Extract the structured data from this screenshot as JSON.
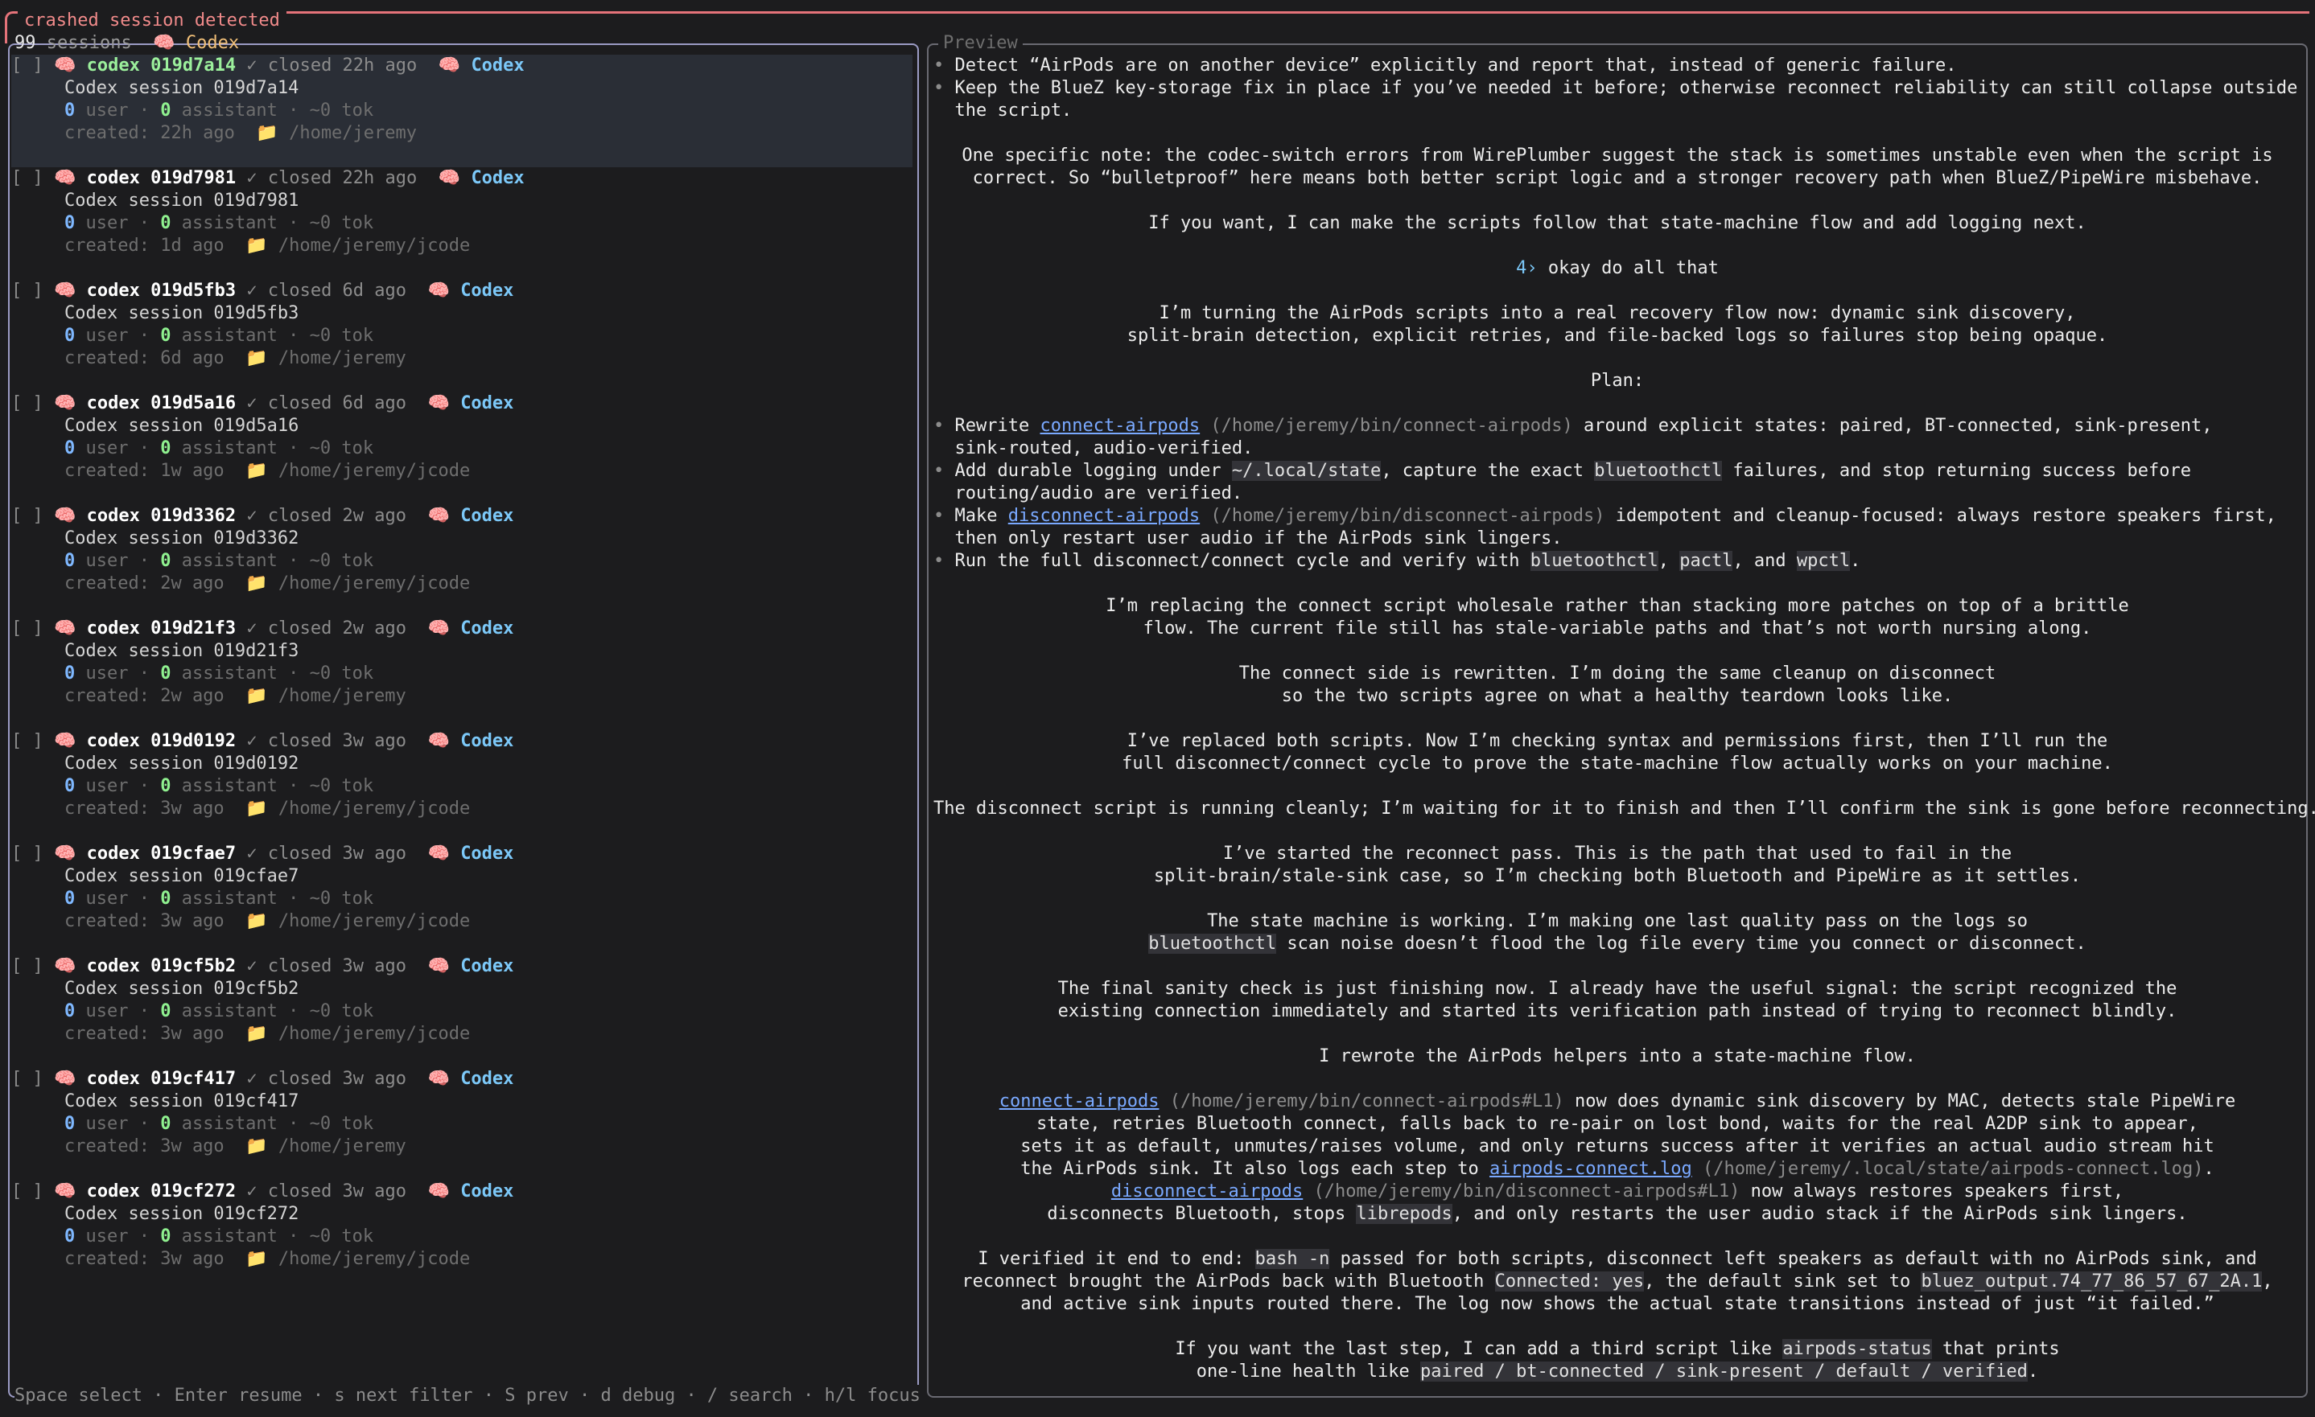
{
  "frame_title": "crashed session detected",
  "left": {
    "count": "99",
    "sessions_word": " sessions",
    "filter": "Codex",
    "footer": "Space select · Enter resume · s next filter · S prev · d debug · / search · h/l focus"
  },
  "sessions": [
    {
      "name": "codex 019d7a14",
      "closed": "closed 22h ago",
      "agent": "Codex",
      "title": "Codex session 019d7a14",
      "user": "0",
      "assistant": "0",
      "tok": "~0 tok",
      "created": "created: 22h ago",
      "path": "/home/jeremy"
    },
    {
      "name": "codex 019d7981",
      "closed": "closed 22h ago",
      "agent": "Codex",
      "title": "Codex session 019d7981",
      "user": "0",
      "assistant": "0",
      "tok": "~0 tok",
      "created": "created: 1d ago",
      "path": "/home/jeremy/jcode"
    },
    {
      "name": "codex 019d5fb3",
      "closed": "closed 6d ago",
      "agent": "Codex",
      "title": "Codex session 019d5fb3",
      "user": "0",
      "assistant": "0",
      "tok": "~0 tok",
      "created": "created: 6d ago",
      "path": "/home/jeremy"
    },
    {
      "name": "codex 019d5a16",
      "closed": "closed 6d ago",
      "agent": "Codex",
      "title": "Codex session 019d5a16",
      "user": "0",
      "assistant": "0",
      "tok": "~0 tok",
      "created": "created: 1w ago",
      "path": "/home/jeremy/jcode"
    },
    {
      "name": "codex 019d3362",
      "closed": "closed 2w ago",
      "agent": "Codex",
      "title": "Codex session 019d3362",
      "user": "0",
      "assistant": "0",
      "tok": "~0 tok",
      "created": "created: 2w ago",
      "path": "/home/jeremy/jcode"
    },
    {
      "name": "codex 019d21f3",
      "closed": "closed 2w ago",
      "agent": "Codex",
      "title": "Codex session 019d21f3",
      "user": "0",
      "assistant": "0",
      "tok": "~0 tok",
      "created": "created: 2w ago",
      "path": "/home/jeremy"
    },
    {
      "name": "codex 019d0192",
      "closed": "closed 3w ago",
      "agent": "Codex",
      "title": "Codex session 019d0192",
      "user": "0",
      "assistant": "0",
      "tok": "~0 tok",
      "created": "created: 3w ago",
      "path": "/home/jeremy/jcode"
    },
    {
      "name": "codex 019cfae7",
      "closed": "closed 3w ago",
      "agent": "Codex",
      "title": "Codex session 019cfae7",
      "user": "0",
      "assistant": "0",
      "tok": "~0 tok",
      "created": "created: 3w ago",
      "path": "/home/jeremy/jcode"
    },
    {
      "name": "codex 019cf5b2",
      "closed": "closed 3w ago",
      "agent": "Codex",
      "title": "Codex session 019cf5b2",
      "user": "0",
      "assistant": "0",
      "tok": "~0 tok",
      "created": "created: 3w ago",
      "path": "/home/jeremy/jcode"
    },
    {
      "name": "codex 019cf417",
      "closed": "closed 3w ago",
      "agent": "Codex",
      "title": "Codex session 019cf417",
      "user": "0",
      "assistant": "0",
      "tok": "~0 tok",
      "created": "created: 3w ago",
      "path": "/home/jeremy"
    },
    {
      "name": "codex 019cf272",
      "closed": "closed 3w ago",
      "agent": "Codex",
      "title": "Codex session 019cf272",
      "user": "0",
      "assistant": "0",
      "tok": "~0 tok",
      "created": "created: 3w ago",
      "path": "/home/jeremy/jcode"
    }
  ],
  "preview": {
    "title": "Preview",
    "lines": [
      {
        "align": "left",
        "bullet": true,
        "segs": [
          {
            "t": "Detect “AirPods are on another device” explicitly and report that, instead of generic failure."
          }
        ]
      },
      {
        "align": "left",
        "bullet": true,
        "segs": [
          {
            "t": "Keep the BlueZ key-storage fix in place if you’ve needed it before; otherwise reconnect reliability can still collapse outside"
          }
        ]
      },
      {
        "align": "left",
        "indent": true,
        "segs": [
          {
            "t": "the script."
          }
        ]
      },
      {
        "align": "left",
        "segs": []
      },
      {
        "align": "center",
        "segs": [
          {
            "t": "One specific note: the codec-switch errors from WirePlumber suggest the stack is sometimes unstable even when the script is"
          }
        ]
      },
      {
        "align": "center",
        "segs": [
          {
            "t": "correct. So “bulletproof” here means both better script logic and a stronger recovery path when BlueZ/PipeWire misbehave."
          }
        ]
      },
      {
        "align": "left",
        "segs": []
      },
      {
        "align": "center",
        "segs": [
          {
            "t": "If you want, I can make the scripts follow that state-machine flow and add logging next."
          }
        ]
      },
      {
        "align": "left",
        "segs": []
      },
      {
        "align": "center",
        "segs": [
          {
            "t": "4›",
            "s": "prompt"
          },
          {
            "t": " okay do all that"
          }
        ]
      },
      {
        "align": "left",
        "segs": []
      },
      {
        "align": "center",
        "segs": [
          {
            "t": "I’m turning the AirPods scripts into a real recovery flow now: dynamic sink discovery,"
          }
        ]
      },
      {
        "align": "center",
        "segs": [
          {
            "t": "split-brain detection, explicit retries, and file-backed logs so failures stop being opaque."
          }
        ]
      },
      {
        "align": "left",
        "segs": []
      },
      {
        "align": "center",
        "segs": [
          {
            "t": "Plan:"
          }
        ]
      },
      {
        "align": "left",
        "segs": []
      },
      {
        "align": "left",
        "bullet": true,
        "segs": [
          {
            "t": "Rewrite "
          },
          {
            "t": "connect-airpods",
            "s": "link"
          },
          {
            "t": " (/home/jeremy/bin/connect-airpods)",
            "s": "path"
          },
          {
            "t": " around explicit states: paired, BT-connected, sink-present,"
          }
        ]
      },
      {
        "align": "left",
        "indent": true,
        "segs": [
          {
            "t": "sink-routed, audio-verified."
          }
        ]
      },
      {
        "align": "left",
        "bullet": true,
        "segs": [
          {
            "t": "Add durable logging under "
          },
          {
            "t": "~/.local/state",
            "s": "code"
          },
          {
            "t": ", capture the exact "
          },
          {
            "t": "bluetoothctl",
            "s": "code"
          },
          {
            "t": " failures, and stop returning success before"
          }
        ]
      },
      {
        "align": "left",
        "indent": true,
        "segs": [
          {
            "t": "routing/audio are verified."
          }
        ]
      },
      {
        "align": "left",
        "bullet": true,
        "segs": [
          {
            "t": "Make "
          },
          {
            "t": "disconnect-airpods",
            "s": "link"
          },
          {
            "t": " (/home/jeremy/bin/disconnect-airpods)",
            "s": "path"
          },
          {
            "t": " idempotent and cleanup-focused: always restore speakers first,"
          }
        ]
      },
      {
        "align": "left",
        "indent": true,
        "segs": [
          {
            "t": "then only restart user audio if the AirPods sink lingers."
          }
        ]
      },
      {
        "align": "left",
        "bullet": true,
        "segs": [
          {
            "t": "Run the full disconnect/connect cycle and verify with "
          },
          {
            "t": "bluetoothctl",
            "s": "code"
          },
          {
            "t": ", "
          },
          {
            "t": "pactl",
            "s": "code"
          },
          {
            "t": ", and "
          },
          {
            "t": "wpctl",
            "s": "code"
          },
          {
            "t": "."
          }
        ]
      },
      {
        "align": "left",
        "segs": []
      },
      {
        "align": "center",
        "segs": [
          {
            "t": "I’m replacing the connect script wholesale rather than stacking more patches on top of a brittle"
          }
        ]
      },
      {
        "align": "center",
        "segs": [
          {
            "t": "flow. The current file still has stale-variable paths and that’s not worth nursing along."
          }
        ]
      },
      {
        "align": "left",
        "segs": []
      },
      {
        "align": "center",
        "segs": [
          {
            "t": "The connect side is rewritten. I’m doing the same cleanup on disconnect"
          }
        ]
      },
      {
        "align": "center",
        "segs": [
          {
            "t": "so the two scripts agree on what a healthy teardown looks like."
          }
        ]
      },
      {
        "align": "left",
        "segs": []
      },
      {
        "align": "center",
        "segs": [
          {
            "t": "I’ve replaced both scripts. Now I’m checking syntax and permissions first, then I’ll run the"
          }
        ]
      },
      {
        "align": "center",
        "segs": [
          {
            "t": "full disconnect/connect cycle to prove the state-machine flow actually works on your machine."
          }
        ]
      },
      {
        "align": "left",
        "segs": []
      },
      {
        "align": "center",
        "segs": [
          {
            "t": "The disconnect script is running cleanly; I’m waiting for it to finish and then I’ll confirm the sink is gone before reconnecting."
          }
        ]
      },
      {
        "align": "left",
        "segs": []
      },
      {
        "align": "center",
        "segs": [
          {
            "t": "I’ve started the reconnect pass. This is the path that used to fail in the"
          }
        ]
      },
      {
        "align": "center",
        "segs": [
          {
            "t": "split-brain/stale-sink case, so I’m checking both Bluetooth and PipeWire as it settles."
          }
        ]
      },
      {
        "align": "left",
        "segs": []
      },
      {
        "align": "center",
        "segs": [
          {
            "t": "The state machine is working. I’m making one last quality pass on the logs so"
          }
        ]
      },
      {
        "align": "center",
        "segs": [
          {
            "t": "bluetoothctl",
            "s": "code"
          },
          {
            "t": " scan noise doesn’t flood the log file every time you connect or disconnect."
          }
        ]
      },
      {
        "align": "left",
        "segs": []
      },
      {
        "align": "center",
        "segs": [
          {
            "t": "The final sanity check is just finishing now. I already have the useful signal: the script recognized the"
          }
        ]
      },
      {
        "align": "center",
        "segs": [
          {
            "t": "existing connection immediately and started its verification path instead of trying to reconnect blindly."
          }
        ]
      },
      {
        "align": "left",
        "segs": []
      },
      {
        "align": "center",
        "segs": [
          {
            "t": "I rewrote the AirPods helpers into a state-machine flow."
          }
        ]
      },
      {
        "align": "left",
        "segs": []
      },
      {
        "align": "center",
        "segs": [
          {
            "t": "connect-airpods",
            "s": "link"
          },
          {
            "t": " (/home/jeremy/bin/connect-airpods#L1)",
            "s": "path"
          },
          {
            "t": " now does dynamic sink discovery by MAC, detects stale PipeWire"
          }
        ]
      },
      {
        "align": "center",
        "segs": [
          {
            "t": "state, retries Bluetooth connect, falls back to re-pair on lost bond, waits for the real A2DP sink to appear,"
          }
        ]
      },
      {
        "align": "center",
        "segs": [
          {
            "t": "sets it as default, unmutes/raises volume, and only returns success after it verifies an actual audio stream hit"
          }
        ]
      },
      {
        "align": "center",
        "segs": [
          {
            "t": "the AirPods sink. It also logs each step to "
          },
          {
            "t": "airpods-connect.log",
            "s": "link"
          },
          {
            "t": " (/home/jeremy/.local/state/airpods-connect.log)",
            "s": "path"
          },
          {
            "t": "."
          }
        ]
      },
      {
        "align": "center",
        "segs": [
          {
            "t": "disconnect-airpods",
            "s": "link"
          },
          {
            "t": " (/home/jeremy/bin/disconnect-airpods#L1)",
            "s": "path"
          },
          {
            "t": " now always restores speakers first,"
          }
        ]
      },
      {
        "align": "center",
        "segs": [
          {
            "t": "disconnects Bluetooth, stops "
          },
          {
            "t": "librepods",
            "s": "code"
          },
          {
            "t": ", and only restarts the user audio stack if the AirPods sink lingers."
          }
        ]
      },
      {
        "align": "left",
        "segs": []
      },
      {
        "align": "center",
        "segs": [
          {
            "t": "I verified it end to end: "
          },
          {
            "t": "bash -n",
            "s": "code"
          },
          {
            "t": " passed for both scripts, disconnect left speakers as default with no AirPods sink, and"
          }
        ]
      },
      {
        "align": "center",
        "segs": [
          {
            "t": "reconnect brought the AirPods back with Bluetooth "
          },
          {
            "t": "Connected: yes",
            "s": "code"
          },
          {
            "t": ", the default sink set to "
          },
          {
            "t": "bluez_output.74_77_86_57_67_2A.1",
            "s": "code"
          },
          {
            "t": ","
          }
        ]
      },
      {
        "align": "center",
        "segs": [
          {
            "t": "and active sink inputs routed there. The log now shows the actual state transitions instead of just “it failed.”"
          }
        ]
      },
      {
        "align": "left",
        "segs": []
      },
      {
        "align": "center",
        "segs": [
          {
            "t": "If you want the last step, I can add a third script like "
          },
          {
            "t": "airpods-status",
            "s": "code"
          },
          {
            "t": " that prints"
          }
        ]
      },
      {
        "align": "center",
        "segs": [
          {
            "t": "one-line health like "
          },
          {
            "t": "paired / bt-connected / sink-present / default / verified",
            "s": "code"
          },
          {
            "t": "."
          }
        ]
      }
    ]
  }
}
